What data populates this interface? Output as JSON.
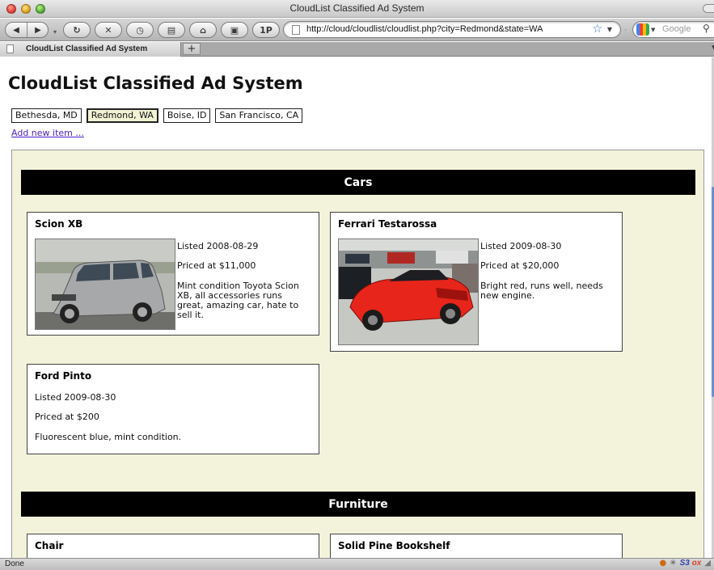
{
  "window": {
    "title": "CloudList Classified Ad System"
  },
  "nav": {
    "url": "http://cloud/cloudlist/cloudlist.php?city=Redmond&state=WA",
    "search_placeholder": "Google",
    "onepassword_label": "1P"
  },
  "tab": {
    "label": "CloudList Classified Ad System",
    "add_label": "+"
  },
  "page": {
    "title": "CloudList Classified Ad System",
    "cities": [
      "Bethesda, MD",
      "Redmond, WA",
      "Boise, ID",
      "San Francisco, CA"
    ],
    "selected_city": "Redmond, WA",
    "add_link": "Add new item ..."
  },
  "categories": [
    {
      "name": "Cars",
      "items": [
        {
          "title": "Scion XB",
          "listed": "Listed 2008-08-29",
          "price": "Priced at $11,000",
          "description": "Mint condition Toyota Scion XB, all accessories runs great, amazing car, hate to sell it.",
          "has_photo": true
        },
        {
          "title": "Ferrari Testarossa",
          "listed": "Listed 2009-08-30",
          "price": "Priced at $20,000",
          "description": "Bright red, runs well, needs new engine.",
          "has_photo": true
        },
        {
          "title": "Ford Pinto",
          "listed": "Listed 2009-08-30",
          "price": "Priced at $200",
          "description": "Fluorescent blue, mint condition.",
          "has_photo": false
        }
      ]
    },
    {
      "name": "Furniture",
      "items": [
        {
          "title": "Chair"
        },
        {
          "title": "Solid Pine Bookshelf"
        }
      ]
    }
  ],
  "status": {
    "text": "Done",
    "addon_label_a": "S3",
    "addon_label_b": "ox"
  },
  "colors": {
    "list_background": "#f3f3dc",
    "selected_city_bg": "#f1f2d4",
    "link": "#4b1ec8",
    "header_bg": "#000000"
  }
}
